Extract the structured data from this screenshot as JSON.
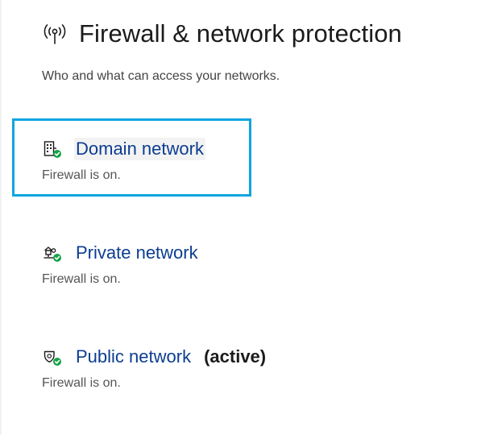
{
  "header": {
    "icon": "wifi-antenna-icon",
    "title": "Firewall & network protection"
  },
  "subtitle": "Who and what can access your networks.",
  "networks": [
    {
      "icon": "domain-building-check-icon",
      "label": "Domain network",
      "status": "Firewall is on.",
      "focused": true
    },
    {
      "icon": "private-network-check-icon",
      "label": "Private network",
      "status": "Firewall is on."
    },
    {
      "icon": "public-network-check-icon",
      "label": "Public network",
      "active_label": "(active)",
      "status": "Firewall is on."
    }
  ],
  "colors": {
    "link": "#0c3d91",
    "focus_ring": "#0ea5e0",
    "check": "#16a34a"
  }
}
